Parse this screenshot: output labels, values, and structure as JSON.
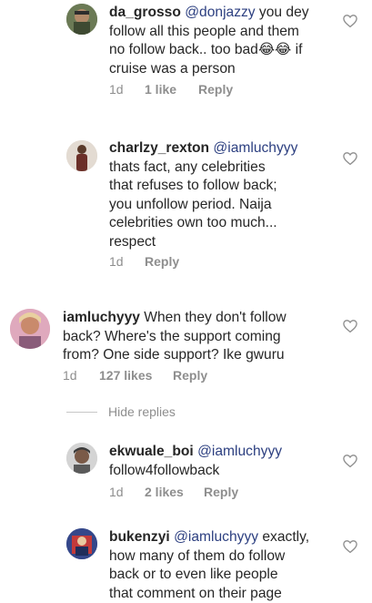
{
  "comments": [
    {
      "username": "da_grosso",
      "mention": "@donjazzy",
      "lines": [
        " you dey",
        "follow all this people and them",
        "no follow back.. too bad😂😂 if",
        "cruise was a person"
      ],
      "time": "1d",
      "likes": "1 like",
      "reply": "Reply"
    },
    {
      "username": "charlzy_rexton",
      "mention": "@iamluchyyy",
      "lines": [
        "",
        "thats fact, any celebrities",
        "that refuses to follow back;",
        "you unfollow  period. Naija",
        "celebrities own too much...",
        "respect"
      ],
      "time": "1d",
      "likes": "",
      "reply": "Reply"
    },
    {
      "username": "iamluchyyy",
      "mention": "",
      "lines": [
        " When they don't follow",
        "back? Where's the support coming",
        "from? One side support? Ike gwuru"
      ],
      "time": "1d",
      "likes": "127 likes",
      "reply": "Reply"
    },
    {
      "username": "ekwuale_boi",
      "mention": "@iamluchyyy",
      "lines": [
        "",
        "follow4followback"
      ],
      "time": "1d",
      "likes": "2 likes",
      "reply": "Reply"
    },
    {
      "username": "bukenzyi",
      "mention": "@iamluchyyy",
      "lines": [
        " exactly,",
        "how many of them do follow",
        "back or to even like people",
        "that comment on their page"
      ],
      "time": "",
      "likes": "",
      "reply": ""
    }
  ],
  "hide_replies": "Hide replies",
  "colors": {
    "text": "#262626",
    "mention": "#2c3f80",
    "meta": "#8e8e8e"
  },
  "icons": {
    "like": "heart-outline-icon"
  }
}
